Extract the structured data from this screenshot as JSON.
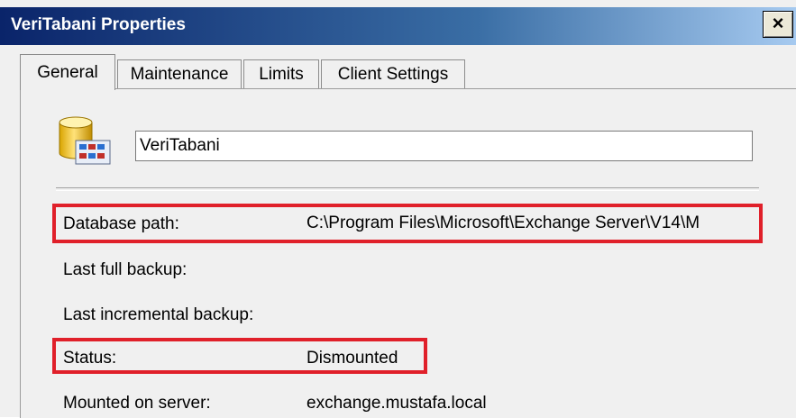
{
  "window": {
    "title": "VeriTabani Properties",
    "close_glyph": "×"
  },
  "tabs": [
    {
      "label": "General",
      "active": true
    },
    {
      "label": "Maintenance",
      "active": false
    },
    {
      "label": "Limits",
      "active": false
    },
    {
      "label": "Client Settings",
      "active": false
    }
  ],
  "general": {
    "icon": "database-mailbox-icon",
    "name_value": "VeriTabani",
    "fields": {
      "database_path_label": "Database path:",
      "database_path_value": "C:\\Program Files\\Microsoft\\Exchange Server\\V14\\M",
      "last_full_backup_label": "Last full backup:",
      "last_incremental_backup_label": "Last incremental backup:",
      "status_label": "Status:",
      "status_value": "Dismounted",
      "mounted_on_server_label": "Mounted on server:",
      "mounted_on_server_value": "exchange.mustafa.local"
    }
  },
  "colors": {
    "highlight": "#e0202a",
    "titlebar_start": "#0a246a",
    "titlebar_end": "#a6caf0"
  }
}
